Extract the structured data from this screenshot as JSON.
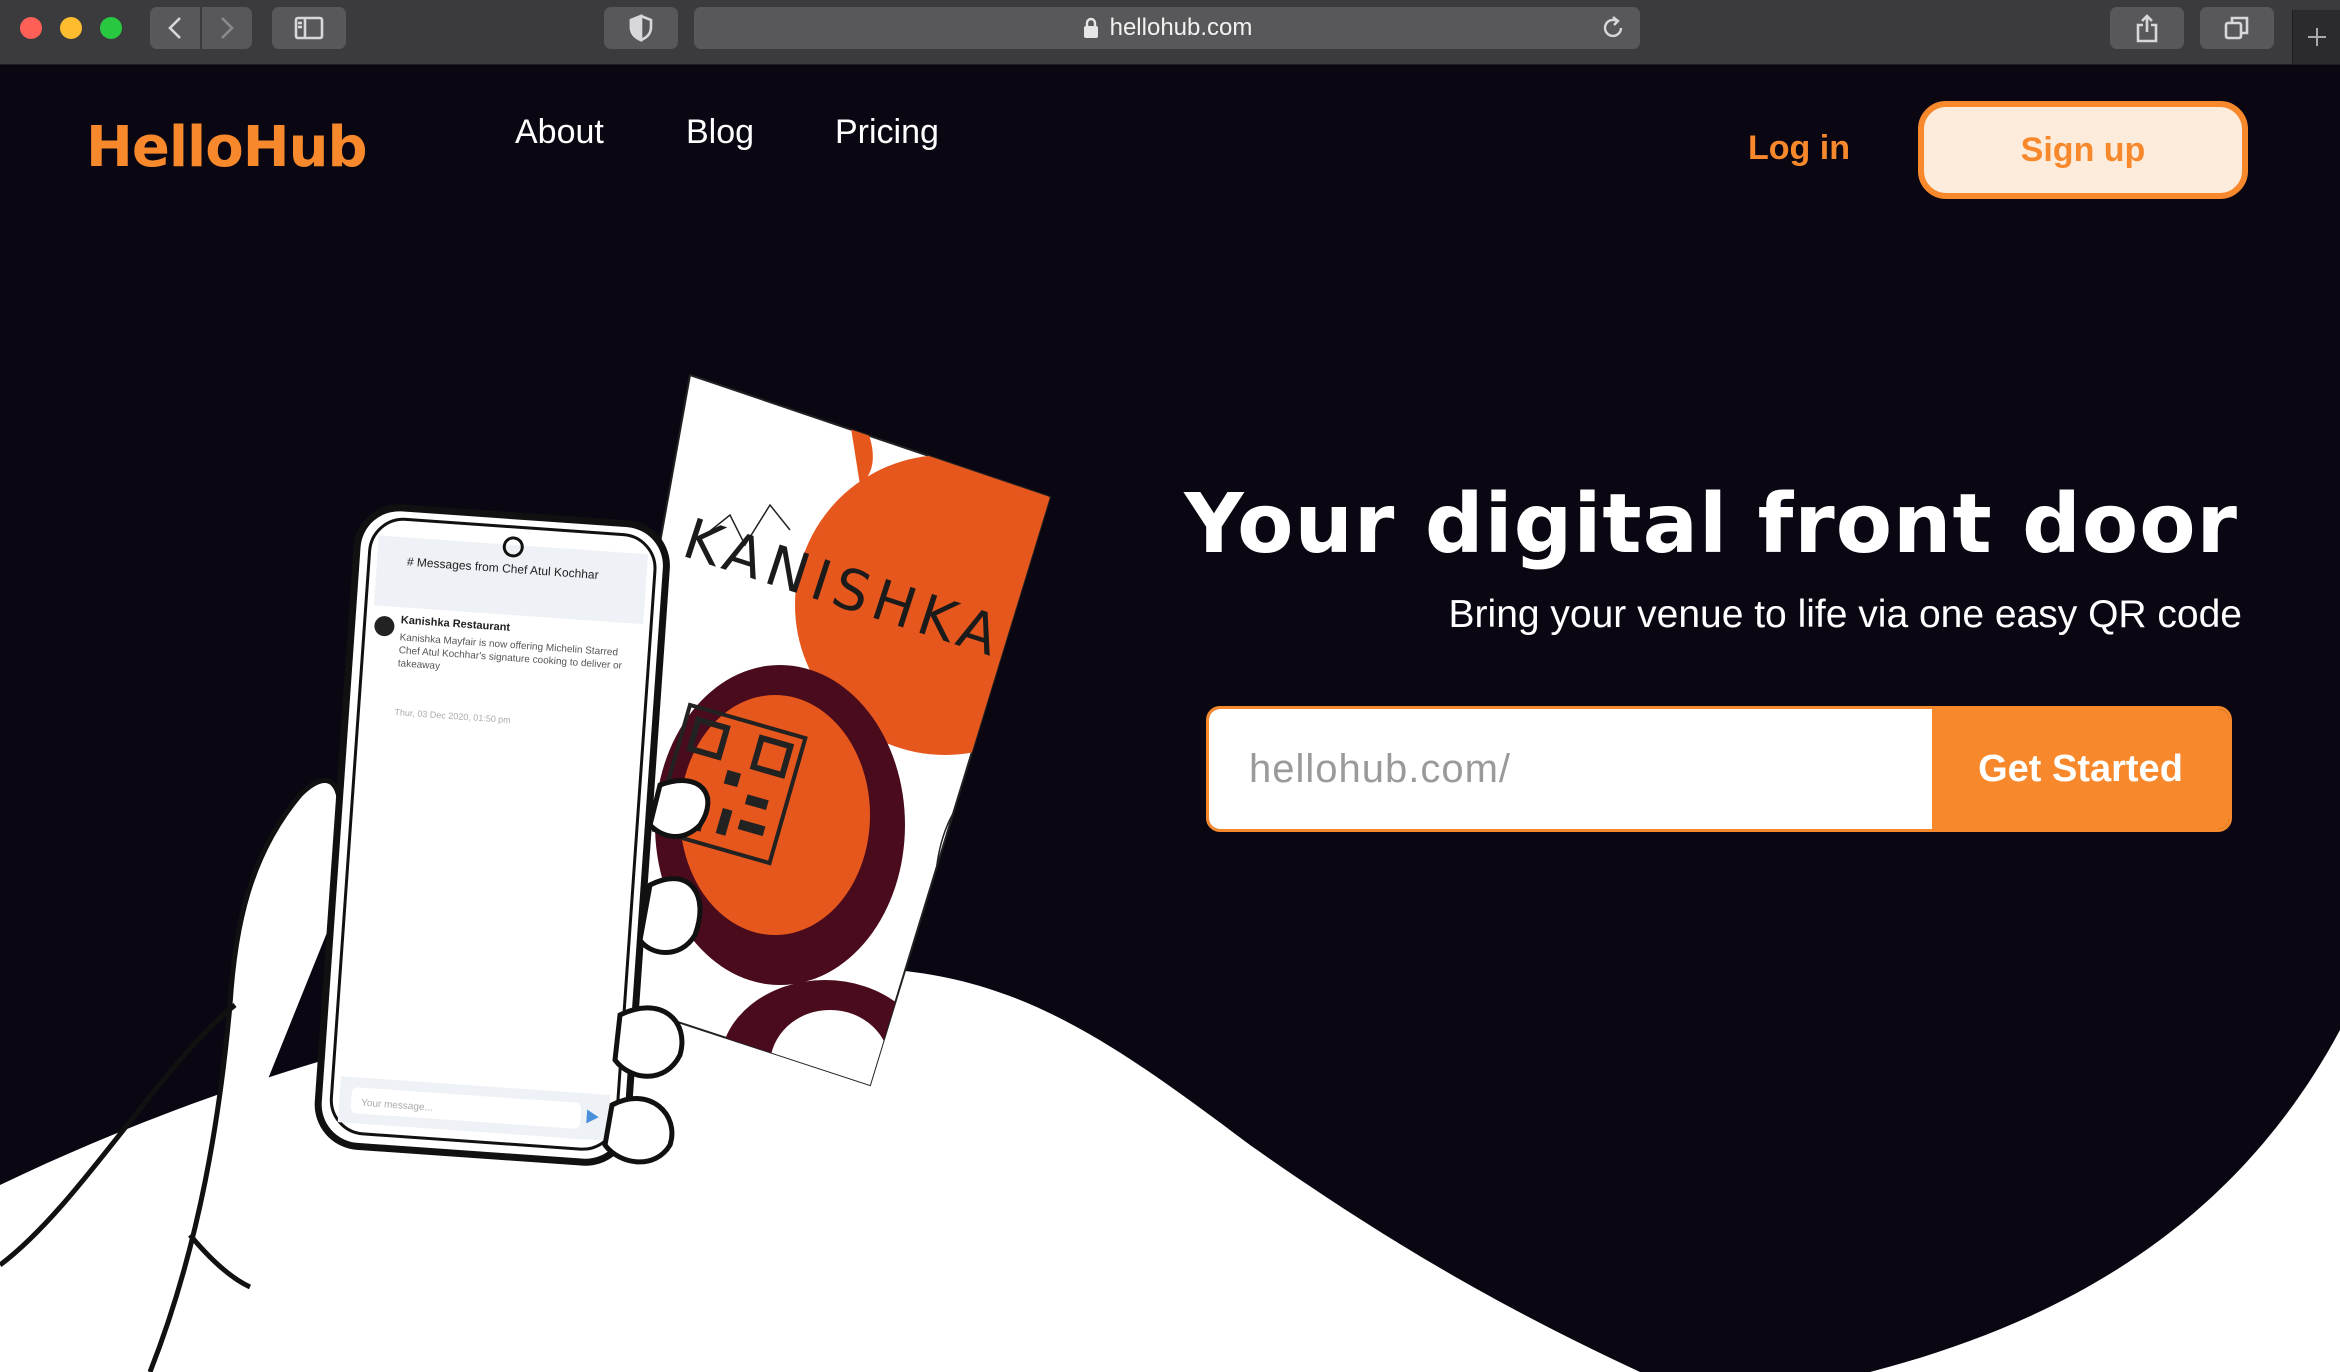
{
  "browser": {
    "url": "hellohub.com",
    "icons": [
      "back-chevron-icon",
      "forward-chevron-icon",
      "sidebar-icon",
      "shield-icon",
      "lock-icon",
      "reload-icon",
      "share-icon",
      "tabs-icon",
      "plus-icon"
    ]
  },
  "header": {
    "logo": "HelloHub",
    "nav": [
      "About",
      "Blog",
      "Pricing"
    ],
    "login": "Log in",
    "signup": "Sign up"
  },
  "hero": {
    "title": "Your digital front door",
    "subtitle": "Bring your venue to life via one easy QR code",
    "input_placeholder": "hellohub.com/",
    "cta": "Get Started"
  },
  "illustration": {
    "card_brand": "KANISHKA",
    "chat_header": "# Messages from Chef Atul Kochhar",
    "sender": "Kanishka Restaurant",
    "message": "Kanishka Mayfair is now offering Michelin Starred Chef Atul Kochhar's signature cooking to deliver or takeaway",
    "timestamp": "Thur, 03 Dec 2020, 01:50 pm",
    "compose_placeholder": "Your message..."
  },
  "colors": {
    "brand_orange": "#f7892c",
    "background": "#0b0712",
    "card_orange": "#e5571d",
    "card_maroon": "#4a0c1c"
  }
}
